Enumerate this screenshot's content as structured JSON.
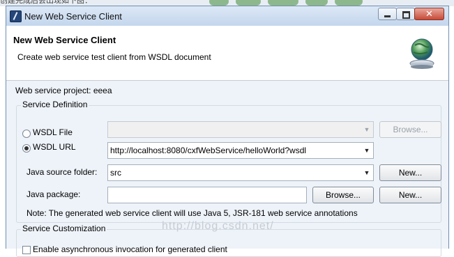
{
  "background_text": "创建完成后会出现如下图：",
  "window": {
    "title": "New Web Service Client",
    "controls": {
      "close_glyph": "✕"
    }
  },
  "banner": {
    "title": "New Web Service Client",
    "description": "Create web service test client from WSDL document",
    "icon": "globe-bell-icon"
  },
  "project": {
    "label": "Web service project: eeea"
  },
  "service_definition": {
    "title": "Service Definition",
    "wsdl_file": {
      "label": "WSDL File",
      "selected": false,
      "value": "",
      "browse_label": "Browse..."
    },
    "wsdl_url": {
      "label": "WSDL URL",
      "selected": true,
      "value": "http://localhost:8080/cxfWebService/helloWorld?wsdl"
    },
    "source_folder": {
      "label": "Java source folder:",
      "value": "src",
      "new_label": "New..."
    },
    "package": {
      "label": "Java package:",
      "value": "",
      "browse_label": "Browse...",
      "new_label": "New..."
    },
    "note": "Note: The generated web service client will use Java 5, JSR-181 web service annotations"
  },
  "service_customization": {
    "title": "Service Customization",
    "async": {
      "label": "Enable asynchronous invocation for generated client",
      "checked": false
    }
  },
  "watermark": "http://blog.csdn.net/",
  "colors": {
    "accent": "#3b6ea5",
    "window_bg": "#eef3f9",
    "close": "#c74a36"
  }
}
